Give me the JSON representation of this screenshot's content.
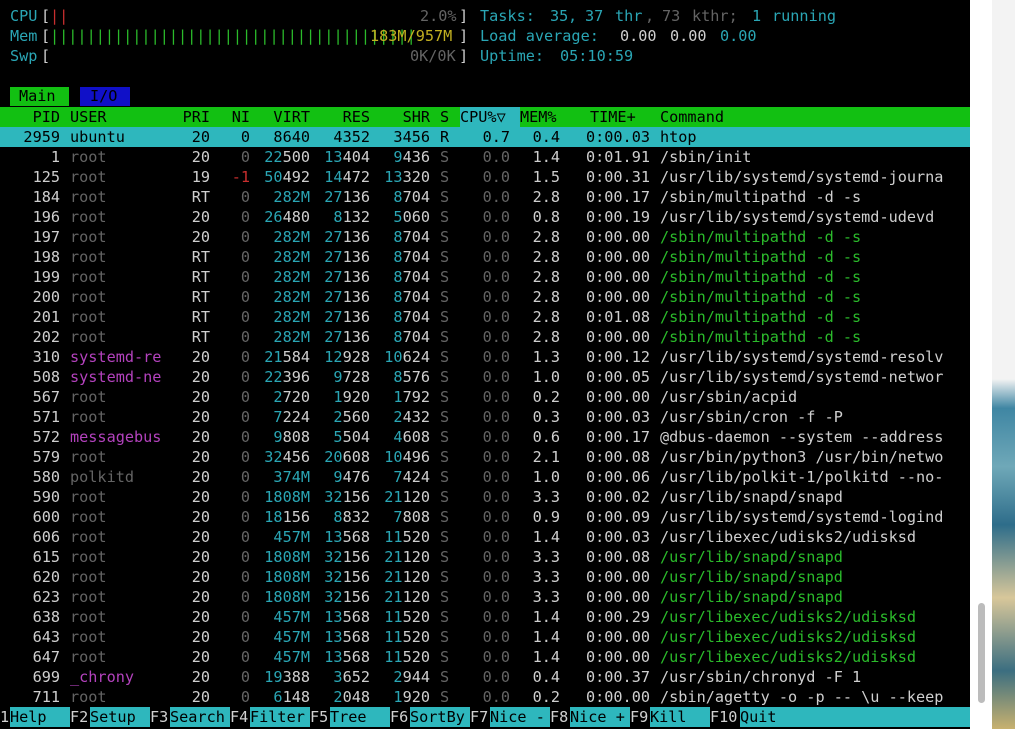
{
  "meters": {
    "cpu": {
      "label": "CPU",
      "bar": "||",
      "value": "2.0%"
    },
    "mem": {
      "label": "Mem",
      "bar": "||||||||||||||||||||||||||||||||||||||||",
      "value": "183M/957M"
    },
    "swp": {
      "label": "Swp",
      "value": "0K/0K"
    },
    "tasks": {
      "label": "Tasks:",
      "tasks": "35",
      "thr": "37",
      "thr_label": "thr",
      "kthr": "73",
      "kthr_label": "kthr;",
      "running": "1",
      "running_label": "running"
    },
    "load": {
      "label": "Load average:",
      "v1": "0.00",
      "v5": "0.00",
      "v15": "0.00"
    },
    "uptime": {
      "label": "Uptime:",
      "value": "05:10:59"
    }
  },
  "tabs": [
    {
      "label": "Main"
    },
    {
      "label": "I/O"
    }
  ],
  "columns": {
    "pid": "PID",
    "user": "USER",
    "pri": "PRI",
    "ni": "NI",
    "virt": "VIRT",
    "res": "RES",
    "shr": "SHR",
    "s": "S",
    "cpu": "CPU%",
    "sort_indicator": "▽",
    "mem": "MEM%",
    "time": "TIME+",
    "command": "Command"
  },
  "processes": [
    {
      "pid": "2959",
      "user": "ubuntu",
      "pri": "20",
      "ni": "0",
      "virt": "8640",
      "res": "4352",
      "shr": "3456",
      "s": "R",
      "cpu": "0.7",
      "mem": "0.4",
      "time": "0:00.03",
      "cmd": "htop",
      "selected": true
    },
    {
      "pid": "1",
      "user": "root",
      "pri": "20",
      "ni": "0",
      "virt": "22500",
      "res": "13404",
      "shr": "9436",
      "s": "S",
      "cpu": "0.0",
      "mem": "1.4",
      "time": "0:01.91",
      "cmd": "/sbin/init"
    },
    {
      "pid": "125",
      "user": "root",
      "pri": "19",
      "ni": "-1",
      "virt": "50492",
      "res": "14472",
      "shr": "13320",
      "s": "S",
      "cpu": "0.0",
      "mem": "1.5",
      "time": "0:00.31",
      "cmd": "/usr/lib/systemd/systemd-journa"
    },
    {
      "pid": "184",
      "user": "root",
      "pri": "RT",
      "ni": "0",
      "virt": "282M",
      "res": "27136",
      "shr": "8704",
      "s": "S",
      "cpu": "0.0",
      "mem": "2.8",
      "time": "0:00.17",
      "cmd": "/sbin/multipathd -d -s"
    },
    {
      "pid": "196",
      "user": "root",
      "pri": "20",
      "ni": "0",
      "virt": "26480",
      "res": "8132",
      "shr": "5060",
      "s": "S",
      "cpu": "0.0",
      "mem": "0.8",
      "time": "0:00.19",
      "cmd": "/usr/lib/systemd/systemd-udevd"
    },
    {
      "pid": "197",
      "user": "root",
      "pri": "20",
      "ni": "0",
      "virt": "282M",
      "res": "27136",
      "shr": "8704",
      "s": "S",
      "cpu": "0.0",
      "mem": "2.8",
      "time": "0:00.00",
      "cmd": "/sbin/multipathd -d -s",
      "thread": true
    },
    {
      "pid": "198",
      "user": "root",
      "pri": "RT",
      "ni": "0",
      "virt": "282M",
      "res": "27136",
      "shr": "8704",
      "s": "S",
      "cpu": "0.0",
      "mem": "2.8",
      "time": "0:00.00",
      "cmd": "/sbin/multipathd -d -s",
      "thread": true
    },
    {
      "pid": "199",
      "user": "root",
      "pri": "RT",
      "ni": "0",
      "virt": "282M",
      "res": "27136",
      "shr": "8704",
      "s": "S",
      "cpu": "0.0",
      "mem": "2.8",
      "time": "0:00.00",
      "cmd": "/sbin/multipathd -d -s",
      "thread": true
    },
    {
      "pid": "200",
      "user": "root",
      "pri": "RT",
      "ni": "0",
      "virt": "282M",
      "res": "27136",
      "shr": "8704",
      "s": "S",
      "cpu": "0.0",
      "mem": "2.8",
      "time": "0:00.00",
      "cmd": "/sbin/multipathd -d -s",
      "thread": true
    },
    {
      "pid": "201",
      "user": "root",
      "pri": "RT",
      "ni": "0",
      "virt": "282M",
      "res": "27136",
      "shr": "8704",
      "s": "S",
      "cpu": "0.0",
      "mem": "2.8",
      "time": "0:01.08",
      "cmd": "/sbin/multipathd -d -s",
      "thread": true
    },
    {
      "pid": "202",
      "user": "root",
      "pri": "RT",
      "ni": "0",
      "virt": "282M",
      "res": "27136",
      "shr": "8704",
      "s": "S",
      "cpu": "0.0",
      "mem": "2.8",
      "time": "0:00.00",
      "cmd": "/sbin/multipathd -d -s",
      "thread": true
    },
    {
      "pid": "310",
      "user": "systemd-re",
      "pri": "20",
      "ni": "0",
      "virt": "21584",
      "res": "12928",
      "shr": "10624",
      "s": "S",
      "cpu": "0.0",
      "mem": "1.3",
      "time": "0:00.12",
      "cmd": "/usr/lib/systemd/systemd-resolv",
      "system_user": true
    },
    {
      "pid": "508",
      "user": "systemd-ne",
      "pri": "20",
      "ni": "0",
      "virt": "22396",
      "res": "9728",
      "shr": "8576",
      "s": "S",
      "cpu": "0.0",
      "mem": "1.0",
      "time": "0:00.05",
      "cmd": "/usr/lib/systemd/systemd-networ",
      "system_user": true
    },
    {
      "pid": "567",
      "user": "root",
      "pri": "20",
      "ni": "0",
      "virt": "2720",
      "res": "1920",
      "shr": "1792",
      "s": "S",
      "cpu": "0.0",
      "mem": "0.2",
      "time": "0:00.00",
      "cmd": "/usr/sbin/acpid"
    },
    {
      "pid": "571",
      "user": "root",
      "pri": "20",
      "ni": "0",
      "virt": "7224",
      "res": "2560",
      "shr": "2432",
      "s": "S",
      "cpu": "0.0",
      "mem": "0.3",
      "time": "0:00.03",
      "cmd": "/usr/sbin/cron -f -P"
    },
    {
      "pid": "572",
      "user": "messagebus",
      "pri": "20",
      "ni": "0",
      "virt": "9808",
      "res": "5504",
      "shr": "4608",
      "s": "S",
      "cpu": "0.0",
      "mem": "0.6",
      "time": "0:00.17",
      "cmd": "@dbus-daemon --system --address",
      "system_user": true
    },
    {
      "pid": "579",
      "user": "root",
      "pri": "20",
      "ni": "0",
      "virt": "32456",
      "res": "20608",
      "shr": "10496",
      "s": "S",
      "cpu": "0.0",
      "mem": "2.1",
      "time": "0:00.08",
      "cmd": "/usr/bin/python3 /usr/bin/netwo"
    },
    {
      "pid": "580",
      "user": "polkitd",
      "pri": "20",
      "ni": "0",
      "virt": "374M",
      "res": "9476",
      "shr": "7424",
      "s": "S",
      "cpu": "0.0",
      "mem": "1.0",
      "time": "0:00.06",
      "cmd": "/usr/lib/polkit-1/polkitd --no-"
    },
    {
      "pid": "590",
      "user": "root",
      "pri": "20",
      "ni": "0",
      "virt": "1808M",
      "res": "32156",
      "shr": "21120",
      "s": "S",
      "cpu": "0.0",
      "mem": "3.3",
      "time": "0:00.02",
      "cmd": "/usr/lib/snapd/snapd"
    },
    {
      "pid": "600",
      "user": "root",
      "pri": "20",
      "ni": "0",
      "virt": "18156",
      "res": "8832",
      "shr": "7808",
      "s": "S",
      "cpu": "0.0",
      "mem": "0.9",
      "time": "0:00.09",
      "cmd": "/usr/lib/systemd/systemd-logind"
    },
    {
      "pid": "606",
      "user": "root",
      "pri": "20",
      "ni": "0",
      "virt": "457M",
      "res": "13568",
      "shr": "11520",
      "s": "S",
      "cpu": "0.0",
      "mem": "1.4",
      "time": "0:00.03",
      "cmd": "/usr/libexec/udisks2/udisksd"
    },
    {
      "pid": "615",
      "user": "root",
      "pri": "20",
      "ni": "0",
      "virt": "1808M",
      "res": "32156",
      "shr": "21120",
      "s": "S",
      "cpu": "0.0",
      "mem": "3.3",
      "time": "0:00.08",
      "cmd": "/usr/lib/snapd/snapd",
      "thread": true
    },
    {
      "pid": "620",
      "user": "root",
      "pri": "20",
      "ni": "0",
      "virt": "1808M",
      "res": "32156",
      "shr": "21120",
      "s": "S",
      "cpu": "0.0",
      "mem": "3.3",
      "time": "0:00.00",
      "cmd": "/usr/lib/snapd/snapd",
      "thread": true
    },
    {
      "pid": "623",
      "user": "root",
      "pri": "20",
      "ni": "0",
      "virt": "1808M",
      "res": "32156",
      "shr": "21120",
      "s": "S",
      "cpu": "0.0",
      "mem": "3.3",
      "time": "0:00.00",
      "cmd": "/usr/lib/snapd/snapd",
      "thread": true
    },
    {
      "pid": "638",
      "user": "root",
      "pri": "20",
      "ni": "0",
      "virt": "457M",
      "res": "13568",
      "shr": "11520",
      "s": "S",
      "cpu": "0.0",
      "mem": "1.4",
      "time": "0:00.29",
      "cmd": "/usr/libexec/udisks2/udisksd",
      "thread": true
    },
    {
      "pid": "643",
      "user": "root",
      "pri": "20",
      "ni": "0",
      "virt": "457M",
      "res": "13568",
      "shr": "11520",
      "s": "S",
      "cpu": "0.0",
      "mem": "1.4",
      "time": "0:00.00",
      "cmd": "/usr/libexec/udisks2/udisksd",
      "thread": true
    },
    {
      "pid": "647",
      "user": "root",
      "pri": "20",
      "ni": "0",
      "virt": "457M",
      "res": "13568",
      "shr": "11520",
      "s": "S",
      "cpu": "0.0",
      "mem": "1.4",
      "time": "0:00.00",
      "cmd": "/usr/libexec/udisks2/udisksd",
      "thread": true
    },
    {
      "pid": "699",
      "user": "_chrony",
      "pri": "20",
      "ni": "0",
      "virt": "19388",
      "res": "3652",
      "shr": "2944",
      "s": "S",
      "cpu": "0.0",
      "mem": "0.4",
      "time": "0:00.37",
      "cmd": "/usr/sbin/chronyd -F 1",
      "system_user": true
    },
    {
      "pid": "711",
      "user": "root",
      "pri": "20",
      "ni": "0",
      "virt": "6148",
      "res": "2048",
      "shr": "1920",
      "s": "S",
      "cpu": "0.0",
      "mem": "0.2",
      "time": "0:00.00",
      "cmd": "/sbin/agetty -o -p -- \\u --keep"
    }
  ],
  "function_keys": [
    {
      "key": "1",
      "label": "Help"
    },
    {
      "key": "F2",
      "label": "Setup"
    },
    {
      "key": "F3",
      "label": "Search"
    },
    {
      "key": "F4",
      "label": "Filter"
    },
    {
      "key": "F5",
      "label": "Tree"
    },
    {
      "key": "F6",
      "label": "SortBy"
    },
    {
      "key": "F7",
      "label": "Nice -"
    },
    {
      "key": "F8",
      "label": "Nice +"
    },
    {
      "key": "F9",
      "label": "Kill"
    },
    {
      "key": "F10",
      "label": "Quit"
    }
  ],
  "colors": {
    "cyan": "#2aa6b5",
    "green": "#12c012",
    "selected_row": "#2eb7bd",
    "magenta": "#b342bd",
    "red": "#c82e2e",
    "yellow": "#c2b021"
  }
}
